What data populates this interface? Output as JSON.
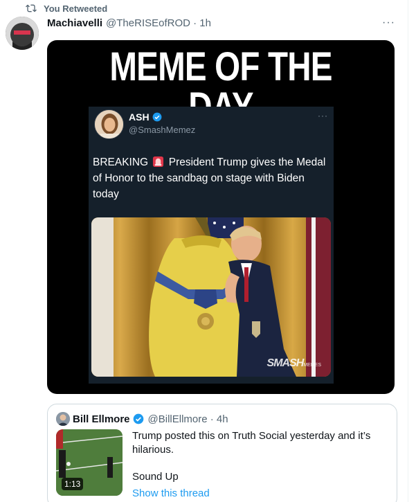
{
  "retweet": {
    "label": "You Retweeted"
  },
  "tweet": {
    "author_name": "Machiavelli",
    "handle_time": "@TheRISEofROD · 1h",
    "more": "···"
  },
  "meme": {
    "title": "MEME OF THE DAY",
    "inner_tweet": {
      "name": "ASH",
      "handle": "@SmashMemez",
      "more": "···",
      "text_before": "BREAKING",
      "text_after": "President Trump gives the Medal of Honor to the sandbag on stage with Biden today"
    },
    "watermark": "SMASH",
    "watermark_small": "MEMES"
  },
  "quote": {
    "name": "Bill Ellmore",
    "handle_time": "@BillEllmore · 4h",
    "text": "Trump posted this on Truth Social yesterday and it’s hilarious.",
    "text2": "Sound Up",
    "duration": "1:13",
    "show_thread": "Show this thread"
  },
  "colors": {
    "accent": "#1d9bf0",
    "muted": "#536471",
    "dark_card": "#15202b"
  },
  "icons": [
    "retweet-icon",
    "verified-icon",
    "siren-icon",
    "more-icon"
  ]
}
